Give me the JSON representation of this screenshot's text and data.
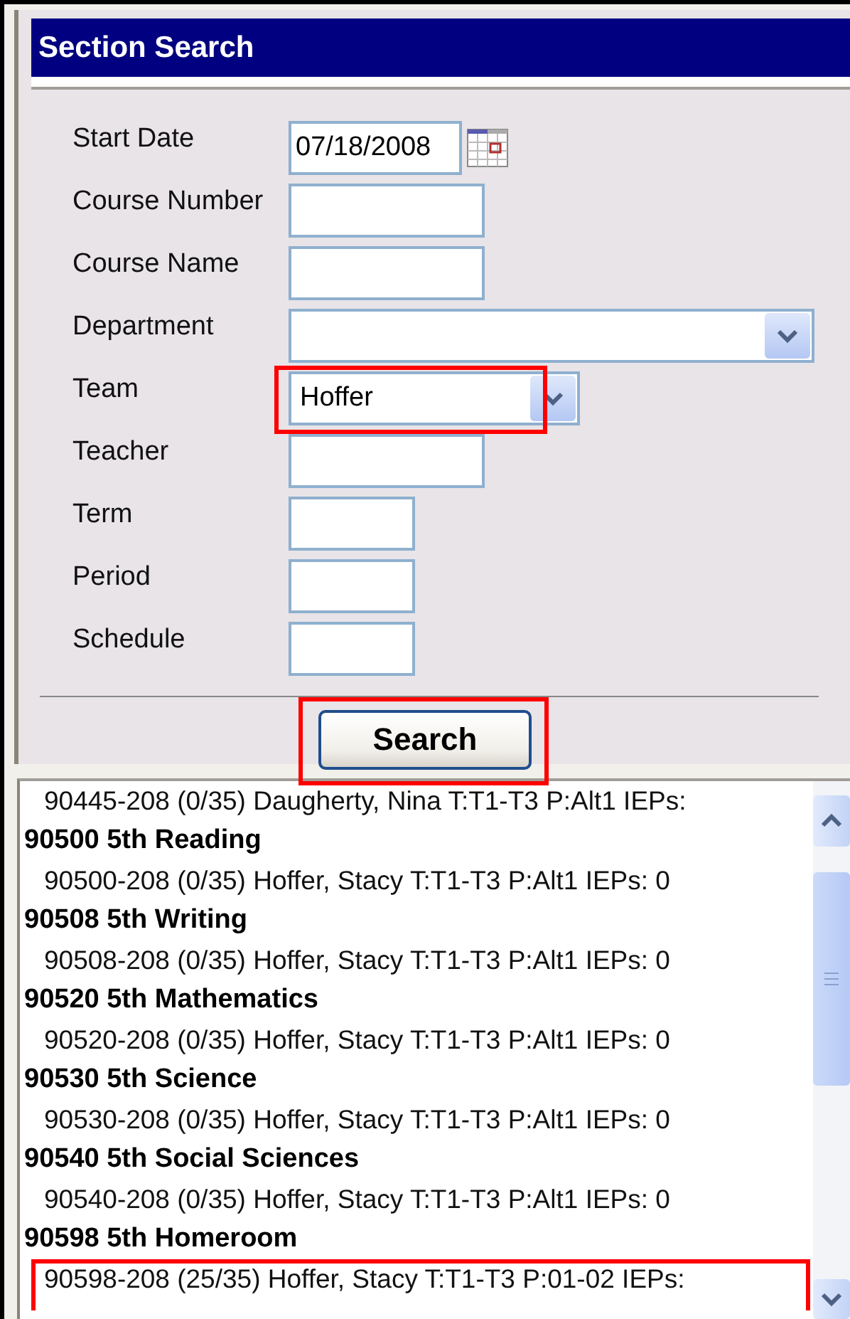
{
  "panel": {
    "title": "Section Search"
  },
  "fields": [
    {
      "label": "Start Date",
      "kind": "date",
      "value": "07/18/2008",
      "highlighted": false
    },
    {
      "label": "Course Number",
      "kind": "text",
      "highlighted": false
    },
    {
      "label": "Course Name",
      "kind": "text",
      "highlighted": false
    },
    {
      "label": "Department",
      "kind": "wide-select",
      "highlighted": false
    },
    {
      "label": "Team",
      "kind": "select",
      "value": "Hoffer",
      "highlighted": true
    },
    {
      "label": "Teacher",
      "kind": "text",
      "highlighted": false
    },
    {
      "label": "Term",
      "kind": "short",
      "highlighted": false
    },
    {
      "label": "Period",
      "kind": "short",
      "highlighted": false
    },
    {
      "label": "Schedule",
      "kind": "short",
      "highlighted": false
    }
  ],
  "search_button": {
    "label": "Search",
    "highlighted": true
  },
  "results": [
    {
      "kind": "section",
      "text": "90445-208 (0/35) Daugherty, Nina T:T1-T3 P:Alt1 IEPs:",
      "highlighted": false
    },
    {
      "kind": "course",
      "text": "90500 5th Reading",
      "highlighted": false
    },
    {
      "kind": "section",
      "text": "90500-208 (0/35) Hoffer, Stacy T:T1-T3 P:Alt1 IEPs: 0",
      "highlighted": false
    },
    {
      "kind": "course",
      "text": "90508 5th Writing",
      "highlighted": false
    },
    {
      "kind": "section",
      "text": "90508-208 (0/35) Hoffer, Stacy T:T1-T3 P:Alt1 IEPs: 0",
      "highlighted": false
    },
    {
      "kind": "course",
      "text": "90520 5th Mathematics",
      "highlighted": false
    },
    {
      "kind": "section",
      "text": "90520-208 (0/35) Hoffer, Stacy T:T1-T3 P:Alt1 IEPs: 0",
      "highlighted": false
    },
    {
      "kind": "course",
      "text": "90530 5th Science",
      "highlighted": false
    },
    {
      "kind": "section",
      "text": "90530-208 (0/35) Hoffer, Stacy T:T1-T3 P:Alt1 IEPs: 0",
      "highlighted": false
    },
    {
      "kind": "course",
      "text": "90540 5th Social Sciences",
      "highlighted": false
    },
    {
      "kind": "section",
      "text": "90540-208 (0/35) Hoffer, Stacy T:T1-T3 P:Alt1 IEPs: 0",
      "highlighted": false
    },
    {
      "kind": "course",
      "text": "90598 5th Homeroom",
      "highlighted": false
    },
    {
      "kind": "section",
      "text": "90598-208 (25/35) Hoffer, Stacy T:T1-T3 P:01-02 IEPs:",
      "highlighted": true
    }
  ]
}
